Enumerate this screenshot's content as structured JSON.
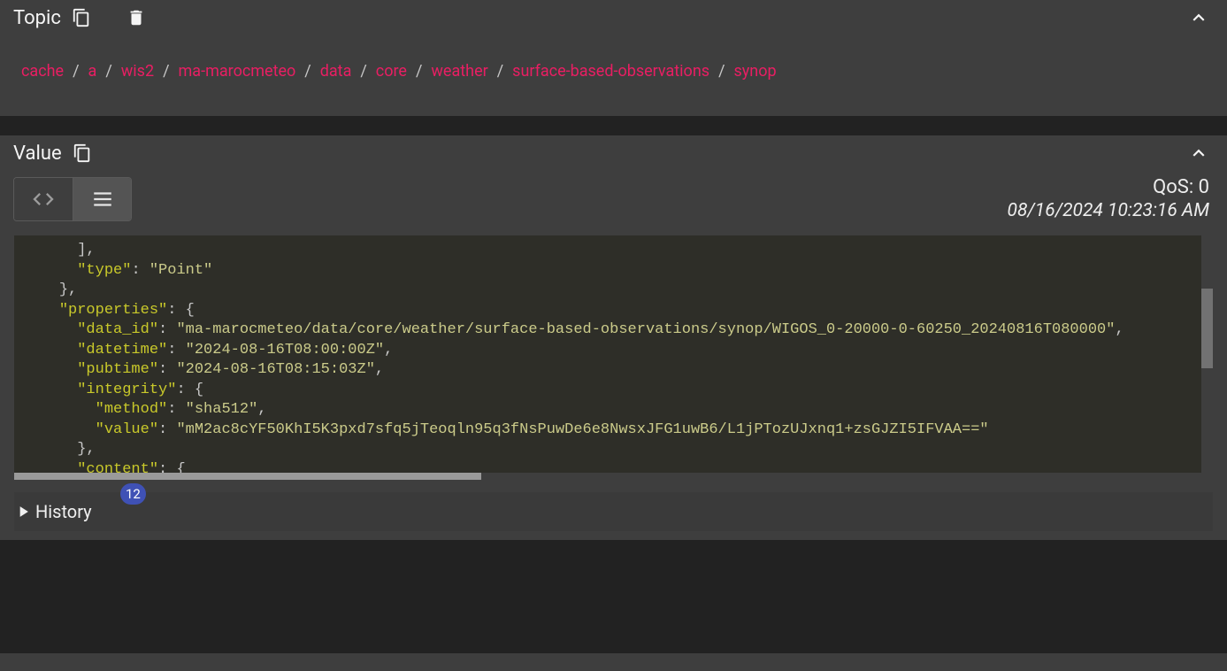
{
  "topic": {
    "title": "Topic",
    "crumbs": [
      "cache",
      "a",
      "wis2",
      "ma-marocmeteo",
      "data",
      "core",
      "weather",
      "surface-based-observations",
      "synop"
    ]
  },
  "value": {
    "title": "Value",
    "qos_label": "QoS: 0",
    "timestamp": "08/16/2024 10:23:16 AM",
    "code_lines": [
      {
        "indent": 6,
        "tokens": [
          {
            "t": "p",
            "v": "],"
          }
        ]
      },
      {
        "indent": 6,
        "tokens": [
          {
            "t": "k",
            "v": "\"type\""
          },
          {
            "t": "p",
            "v": ": "
          },
          {
            "t": "s",
            "v": "\"Point\""
          }
        ]
      },
      {
        "indent": 4,
        "tokens": [
          {
            "t": "p",
            "v": "},"
          }
        ]
      },
      {
        "indent": 4,
        "tokens": [
          {
            "t": "k",
            "v": "\"properties\""
          },
          {
            "t": "p",
            "v": ": {"
          }
        ]
      },
      {
        "indent": 6,
        "tokens": [
          {
            "t": "k",
            "v": "\"data_id\""
          },
          {
            "t": "p",
            "v": ": "
          },
          {
            "t": "s",
            "v": "\"ma-marocmeteo/data/core/weather/surface-based-observations/synop/WIGOS_0-20000-0-60250_20240816T080000\""
          },
          {
            "t": "p",
            "v": ","
          }
        ]
      },
      {
        "indent": 6,
        "tokens": [
          {
            "t": "k",
            "v": "\"datetime\""
          },
          {
            "t": "p",
            "v": ": "
          },
          {
            "t": "s",
            "v": "\"2024-08-16T08:00:00Z\""
          },
          {
            "t": "p",
            "v": ","
          }
        ]
      },
      {
        "indent": 6,
        "tokens": [
          {
            "t": "k",
            "v": "\"pubtime\""
          },
          {
            "t": "p",
            "v": ": "
          },
          {
            "t": "s",
            "v": "\"2024-08-16T08:15:03Z\""
          },
          {
            "t": "p",
            "v": ","
          }
        ]
      },
      {
        "indent": 6,
        "tokens": [
          {
            "t": "k",
            "v": "\"integrity\""
          },
          {
            "t": "p",
            "v": ": {"
          }
        ]
      },
      {
        "indent": 8,
        "tokens": [
          {
            "t": "k",
            "v": "\"method\""
          },
          {
            "t": "p",
            "v": ": "
          },
          {
            "t": "s",
            "v": "\"sha512\""
          },
          {
            "t": "p",
            "v": ","
          }
        ]
      },
      {
        "indent": 8,
        "tokens": [
          {
            "t": "k",
            "v": "\"value\""
          },
          {
            "t": "p",
            "v": ": "
          },
          {
            "t": "s",
            "v": "\"mM2ac8cYF50KhI5K3pxd7sfq5jTeoqln95q3fNsPuwDe6e8NwsxJFG1uwB6/L1jPTozUJxnq1+zsGJZI5IFVAA==\""
          }
        ]
      },
      {
        "indent": 6,
        "tokens": [
          {
            "t": "p",
            "v": "},"
          }
        ]
      },
      {
        "indent": 6,
        "tokens": [
          {
            "t": "k",
            "v": "\"content\""
          },
          {
            "t": "p",
            "v": ": {"
          }
        ]
      }
    ]
  },
  "history": {
    "label": "History",
    "count": "12"
  }
}
